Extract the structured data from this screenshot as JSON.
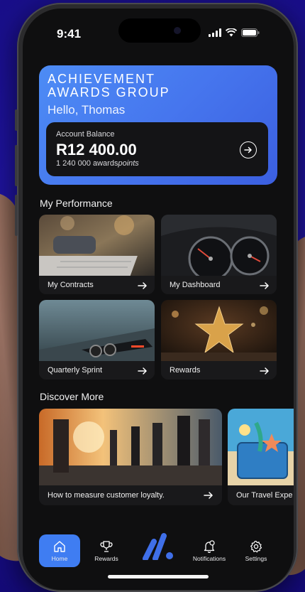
{
  "status": {
    "time": "9:41"
  },
  "hero": {
    "brand_line1": "ACHIEVEMENT",
    "brand_line2": "AWARDS GROUP",
    "greeting": "Hello, Thomas",
    "balance_label": "Account Balance",
    "balance_amount": "R12 400.00",
    "points_value": "1 240 000 awards",
    "points_suffix": "points"
  },
  "performance": {
    "title": "My Performance",
    "tiles": [
      {
        "label": "My Contracts",
        "icon": "contracts-image"
      },
      {
        "label": "My Dashboard",
        "icon": "dashboard-image"
      },
      {
        "label": "Quarterly Sprint",
        "icon": "sprint-image"
      },
      {
        "label": "Rewards",
        "icon": "star-image"
      }
    ]
  },
  "discover": {
    "title": "Discover More",
    "cards": [
      {
        "label": "How to measure customer loyalty."
      },
      {
        "label": "Our Travel Expe"
      }
    ]
  },
  "nav": {
    "items": [
      {
        "label": "Home",
        "icon": "home-icon",
        "active": true
      },
      {
        "label": "Rewards",
        "icon": "trophy-icon",
        "active": false
      },
      {
        "label": "",
        "icon": "brand-logo",
        "active": false
      },
      {
        "label": "Notifications",
        "icon": "bell-icon",
        "active": false
      },
      {
        "label": "Settings",
        "icon": "gear-icon",
        "active": false
      }
    ]
  },
  "colors": {
    "background": "#1d1299",
    "hero_gradient_start": "#4d8cf5",
    "accent": "#3f7df2",
    "screen": "#0f0f10"
  }
}
